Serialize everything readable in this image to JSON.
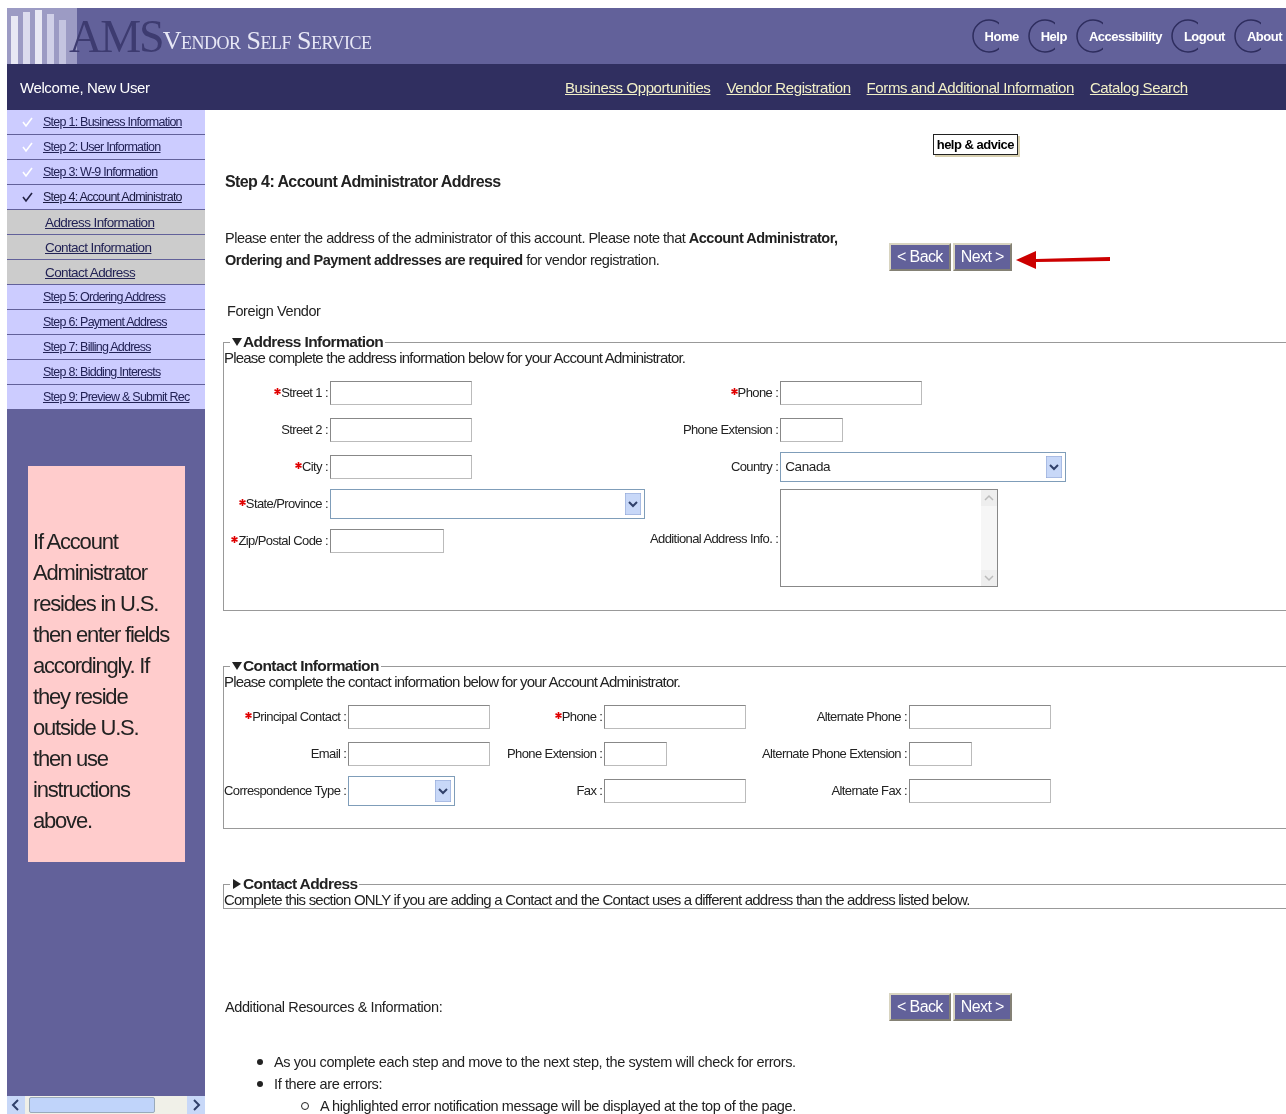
{
  "header": {
    "logo_initials": "AMS",
    "title": "Vendor Self Service",
    "nav": [
      "Home",
      "Help",
      "Accessibility",
      "Logout",
      "About"
    ]
  },
  "subnav": {
    "welcome": "Welcome, New User",
    "links": [
      "Business Opportunities",
      "Vendor Registration",
      "Forms and Additional Information",
      "Catalog Search"
    ]
  },
  "sidebar": {
    "steps": [
      {
        "label": "Step 1: Business Information",
        "checked": true,
        "selected": false
      },
      {
        "label": "Step 2: User Information",
        "checked": true,
        "selected": false
      },
      {
        "label": "Step 3: W-9 Information",
        "checked": true,
        "selected": false
      },
      {
        "label": "Step 4: Account Administrato",
        "checked": true,
        "selected": true,
        "children": [
          {
            "label": "Address Information"
          },
          {
            "label": "Contact Information"
          },
          {
            "label": "Contact Address"
          }
        ]
      },
      {
        "label": "Step 5: Ordering Address",
        "checked": false,
        "selected": false
      },
      {
        "label": "Step 6: Payment Address",
        "checked": false,
        "selected": false
      },
      {
        "label": "Step 7: Billing Address",
        "checked": false,
        "selected": false
      },
      {
        "label": "Step 8: Bidding Interests",
        "checked": false,
        "selected": false
      },
      {
        "label": "Step 9: Preview & Submit Rec",
        "checked": false,
        "selected": false
      }
    ],
    "note": "If Account Administrator resides in U.S. then enter fields accordingly.  If they reside outside U.S. then use instructions above."
  },
  "page": {
    "help_button": "help & advice",
    "title": "Step 4: Account Administrator Address",
    "intro": "Please enter the address of the administrator of this account. Please note that **Account Administrator, Ordering and Payment addresses are required** for vendor registration.",
    "buttons": [
      "< Back",
      "Next >"
    ],
    "vendor_type": "Foreign Vendor"
  },
  "sections": [
    {
      "title": "Address Information",
      "expanded": true,
      "description": "Please complete the address information below for your Account Administrator.",
      "columns": [
        [
          {
            "label": "Street 1 :",
            "required": true,
            "kind": "text"
          },
          {
            "label": "Street 2 :",
            "required": false,
            "kind": "text"
          },
          {
            "label": "City :",
            "required": true,
            "kind": "text"
          },
          {
            "label": "State/Province :",
            "required": true,
            "kind": "select"
          },
          {
            "label": "Zip/Postal Code :",
            "required": true,
            "kind": "short-text"
          }
        ],
        [
          {
            "label": "Phone :",
            "required": true,
            "kind": "text"
          },
          {
            "label": "Phone Extension :",
            "required": false,
            "kind": "tiny-text"
          },
          {
            "label": "Country :",
            "required": false,
            "kind": "select",
            "value": "Canada"
          },
          {
            "label": "Additional Address Info. :",
            "required": false,
            "kind": "textarea"
          }
        ]
      ]
    },
    {
      "title": "Contact Information",
      "expanded": true,
      "description": "Please complete the contact information below for your Account Administrator.",
      "columns": [
        [
          {
            "label": "Principal Contact :",
            "required": true,
            "kind": "text"
          },
          {
            "label": "Email :",
            "required": false,
            "kind": "text"
          },
          {
            "label": "Correspondence Type :",
            "required": false,
            "kind": "short-select"
          }
        ],
        [
          {
            "label": "Phone :",
            "required": true,
            "kind": "text"
          },
          {
            "label": "Phone Extension :",
            "required": false,
            "kind": "tiny-text"
          },
          {
            "label": "Fax :",
            "required": false,
            "kind": "text"
          }
        ],
        [
          {
            "label": "Alternate Phone :",
            "required": false,
            "kind": "text"
          },
          {
            "label": "Alternate Phone Extension :",
            "required": false,
            "kind": "tiny-text"
          },
          {
            "label": "Alternate Fax :",
            "required": false,
            "kind": "text"
          }
        ]
      ]
    },
    {
      "title": "Contact Address",
      "expanded": false,
      "description": "Complete this section ONLY if you are adding a Contact and the Contact uses a different address than the address listed below."
    }
  ],
  "resources": {
    "title": "Additional Resources & Information:",
    "buttons": [
      "< Back",
      "Next >"
    ],
    "bullets": [
      {
        "text": "As you complete each step and move to the next step, the system will check for errors."
      },
      {
        "text": "If there are errors:",
        "children": [
          {
            "text": "A highlighted error notification message will be displayed at the top of the page."
          }
        ]
      }
    ]
  }
}
